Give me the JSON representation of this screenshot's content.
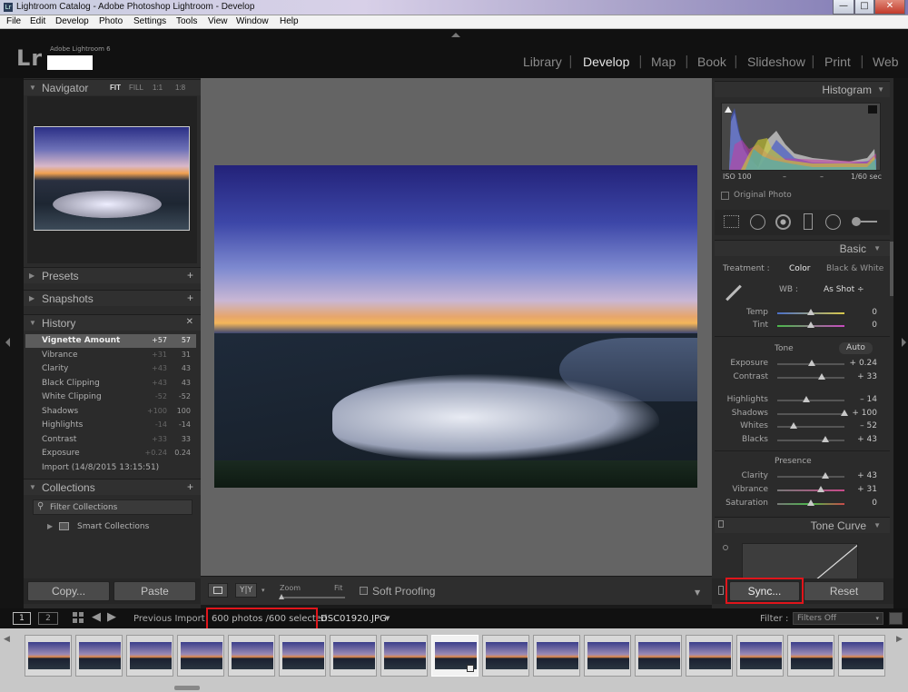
{
  "window": {
    "title": "Lightroom Catalog - Adobe Photoshop Lightroom - Develop",
    "app_icon": "Lr",
    "minimize": "—",
    "maximize": "□",
    "close": "✕"
  },
  "menu": [
    "File",
    "Edit",
    "Develop",
    "Photo",
    "Settings",
    "Tools",
    "View",
    "Window",
    "Help"
  ],
  "header": {
    "logo": "Lr",
    "product": "Adobe Lightroom 6"
  },
  "modules": [
    "Library",
    "Develop",
    "Map",
    "Book",
    "Slideshow",
    "Print",
    "Web"
  ],
  "active_module": "Develop",
  "left": {
    "navigator": {
      "title": "Navigator",
      "zoom_options": [
        "FIT",
        "FILL",
        "1:1",
        "1:8"
      ]
    },
    "presets": {
      "title": "Presets",
      "action": "+"
    },
    "snapshots": {
      "title": "Snapshots",
      "action": "+"
    },
    "history": {
      "title": "History",
      "action": "✕",
      "items": [
        {
          "name": "Vignette Amount",
          "from": "+57",
          "to": "57"
        },
        {
          "name": "Vibrance",
          "from": "+31",
          "to": "31"
        },
        {
          "name": "Clarity",
          "from": "+43",
          "to": "43"
        },
        {
          "name": "Black Clipping",
          "from": "+43",
          "to": "43"
        },
        {
          "name": "White Clipping",
          "from": "-52",
          "to": "-52"
        },
        {
          "name": "Shadows",
          "from": "+100",
          "to": "100"
        },
        {
          "name": "Highlights",
          "from": "-14",
          "to": "-14"
        },
        {
          "name": "Contrast",
          "from": "+33",
          "to": "33"
        },
        {
          "name": "Exposure",
          "from": "+0.24",
          "to": "0.24"
        },
        {
          "name": "Import (14/8/2015 13:15:51)",
          "from": "",
          "to": ""
        }
      ]
    },
    "collections": {
      "title": "Collections",
      "action": "+",
      "filter_placeholder": "Filter Collections",
      "smart": "Smart Collections"
    },
    "copy_button": "Copy...",
    "paste_button": "Paste"
  },
  "toolbar": {
    "zoom_label": "Zoom",
    "fit_label": "Fit",
    "soft_proofing": "Soft Proofing"
  },
  "right": {
    "histogram": {
      "title": "Histogram",
      "iso": "ISO 100",
      "dash1": "–",
      "dash2": "–",
      "shutter": "1/60 sec",
      "original_photo": "Original Photo"
    },
    "basic": {
      "title": "Basic",
      "treatment_label": "Treatment :",
      "treatment_color": "Color",
      "treatment_bw": "Black & White",
      "wb_label": "WB :",
      "wb_value": "As Shot ÷",
      "tone_label": "Tone",
      "auto": "Auto",
      "presence_label": "Presence",
      "temp": {
        "label": "Temp",
        "value": "0",
        "level": 0.5
      },
      "tint": {
        "label": "Tint",
        "value": "0",
        "level": 0.5
      },
      "exposure": {
        "label": "Exposure",
        "value": "+ 0.24",
        "level": 0.52
      },
      "contrast": {
        "label": "Contrast",
        "value": "+ 33",
        "level": 0.66
      },
      "highlights": {
        "label": "Highlights",
        "value": "– 14",
        "level": 0.43
      },
      "shadows": {
        "label": "Shadows",
        "value": "+ 100",
        "level": 1.0
      },
      "whites": {
        "label": "Whites",
        "value": "– 52",
        "level": 0.24
      },
      "blacks": {
        "label": "Blacks",
        "value": "+ 43",
        "level": 0.71
      },
      "clarity": {
        "label": "Clarity",
        "value": "+ 43",
        "level": 0.71
      },
      "vibrance": {
        "label": "Vibrance",
        "value": "+ 31",
        "level": 0.65
      },
      "saturation": {
        "label": "Saturation",
        "value": "0",
        "level": 0.5
      }
    },
    "tone_curve": {
      "title": "Tone Curve"
    },
    "sync_button": "Sync...",
    "reset_button": "Reset"
  },
  "filmstrip": {
    "page1": "1",
    "page2": "2",
    "source": "Previous Import",
    "count": "600 photos /600 selected",
    "filename": "DSC01920.JPG",
    "filter_label": "Filter :",
    "filter_value": "Filters Off"
  },
  "colors": {
    "accent_red": "#e0151b",
    "panel_bg": "#2b2b2b",
    "canvas_bg": "#646464"
  }
}
